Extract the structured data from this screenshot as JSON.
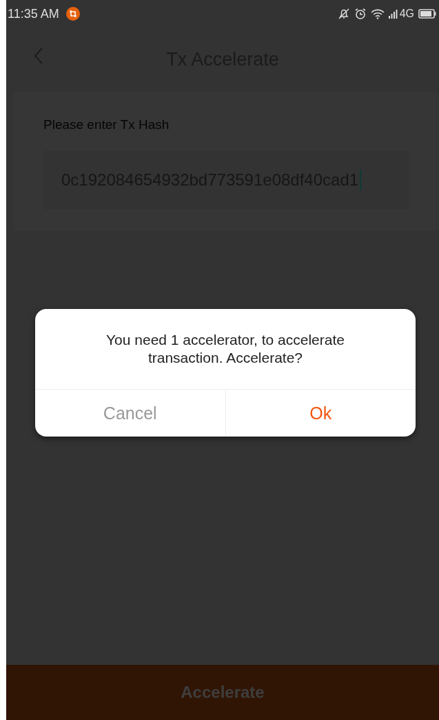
{
  "status_bar": {
    "time": "11:35 AM",
    "network": "4G"
  },
  "nav": {
    "title": "Tx Accelerate"
  },
  "form": {
    "label": "Please enter Tx Hash",
    "value": "0c192084654932bd773591e08df40cad1"
  },
  "dialog": {
    "message": "You need 1 accelerator, to accelerate transaction. Accelerate?",
    "buttons": [
      {
        "label": "Cancel",
        "kind": "cancel"
      },
      {
        "label": "Ok",
        "kind": "confirm"
      }
    ]
  },
  "bottom_button": {
    "label": "Accelerate"
  }
}
